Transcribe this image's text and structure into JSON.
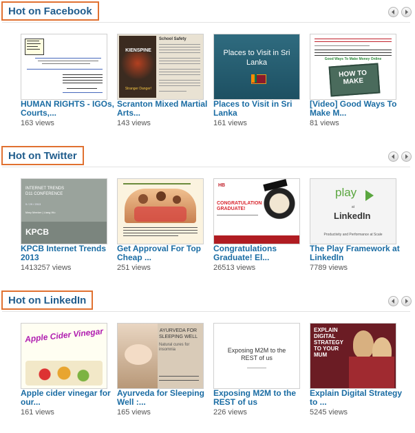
{
  "sections": [
    {
      "title": "Hot on Facebook",
      "items": [
        {
          "title": "HUMAN RIGHTS - IGOs, Courts,...",
          "views": "163 views"
        },
        {
          "title": "Scranton Mixed Martial Arts...",
          "views": "143 views",
          "thumb_text": "KIENSPINE",
          "thumb_sub": "Stranger Danger!",
          "thumb_heading": "School Safety"
        },
        {
          "title": "Places to Visit in Sri Lanka",
          "views": "161 views",
          "thumb_text": "Places to Visit in Sri Lanka"
        },
        {
          "title": "[Video] Good Ways To Make M...",
          "views": "81 views",
          "thumb_text": "HOW TO MAKE",
          "thumb_sub": "Good Ways To Make Money Online"
        }
      ]
    },
    {
      "title": "Hot on Twitter",
      "items": [
        {
          "title": "KPCB Internet Trends 2013",
          "views": "1413257 views",
          "thumb_text": "INTERNET TRENDS D11 CONFERENCE",
          "thumb_sub": "KPCB",
          "thumb_date": "5 / 29 / 2013",
          "thumb_author": "Mary Meeker | Liang Wu"
        },
        {
          "title": "Get Approval For Top Cheap ...",
          "views": "251 views"
        },
        {
          "title": "Congratulations Graduate! El...",
          "views": "26513 views",
          "thumb_text": "CONGRATULATIONS GRADUATE!",
          "thumb_sub": "HB"
        },
        {
          "title": "The Play Framework at LinkedIn",
          "views": "7789 views",
          "thumb_text": "play",
          "thumb_sub": "LinkedIn",
          "thumb_at": "at",
          "thumb_caption": "Productivity and Performance at Scale"
        }
      ]
    },
    {
      "title": "Hot on LinkedIn",
      "items": [
        {
          "title": "Apple cider vinegar for our...",
          "views": "161 views",
          "thumb_text": "Apple Cider Vinegar"
        },
        {
          "title": "Ayurveda for Sleeping Well :...",
          "views": "165 views",
          "thumb_text": "AYURVEDA FOR SLEEPING WELL",
          "thumb_sub": "Natural cures for insomnia"
        },
        {
          "title": "Exposing M2M to the REST of us",
          "views": "226 views",
          "thumb_text": "Exposing M2M to the REST of us"
        },
        {
          "title": "Explain Digital Strategy to ...",
          "views": "5245 views",
          "thumb_text": "EXPLAIN DIGITAL STRATEGY TO YOUR MUM"
        }
      ]
    }
  ],
  "colors": {
    "accent_border": "#e0702f",
    "heading": "#1f5c8c",
    "link": "#1a6ca3"
  }
}
